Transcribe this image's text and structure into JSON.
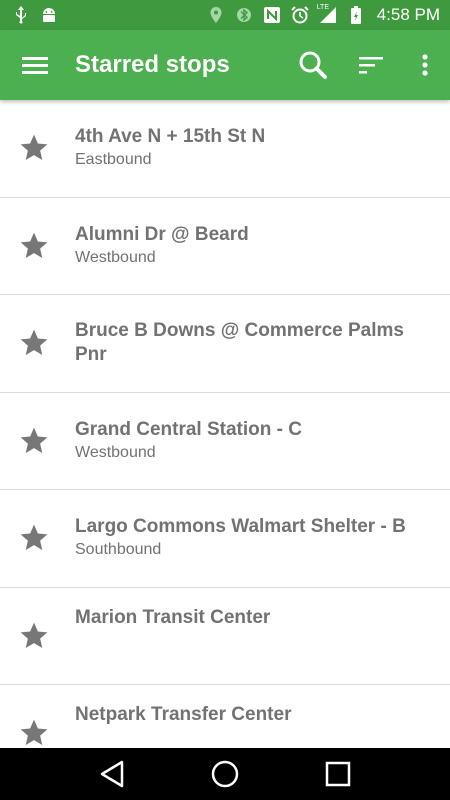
{
  "status_bar": {
    "time": "4:58 PM",
    "left_icons": [
      "usb-icon",
      "android-icon"
    ],
    "right_icons": [
      "location-icon",
      "bluetooth-icon",
      "nfc-icon",
      "alarm-icon",
      "lte-signal-icon",
      "battery-icon"
    ],
    "lte_label": "LTE"
  },
  "app_bar": {
    "title": "Starred stops",
    "color": "#4caf50",
    "status_color": "#3f9a3f",
    "actions": [
      "search-icon",
      "sort-icon",
      "more-vert-icon"
    ]
  },
  "stops": [
    {
      "name": "4th Ave N + 15th St N",
      "direction": "Eastbound"
    },
    {
      "name": "Alumni Dr @ Beard",
      "direction": "Westbound"
    },
    {
      "name": "Bruce B Downs @ Commerce Palms Pnr",
      "direction": ""
    },
    {
      "name": "Grand Central Station - C",
      "direction": "Westbound"
    },
    {
      "name": "Largo Commons Walmart Shelter - B",
      "direction": "Southbound"
    },
    {
      "name": "Marion Transit Center",
      "direction": ""
    },
    {
      "name": "Netpark Transfer Center",
      "direction": ""
    }
  ],
  "nav_bar": {
    "buttons": [
      "back-icon",
      "home-icon",
      "recents-icon"
    ]
  }
}
